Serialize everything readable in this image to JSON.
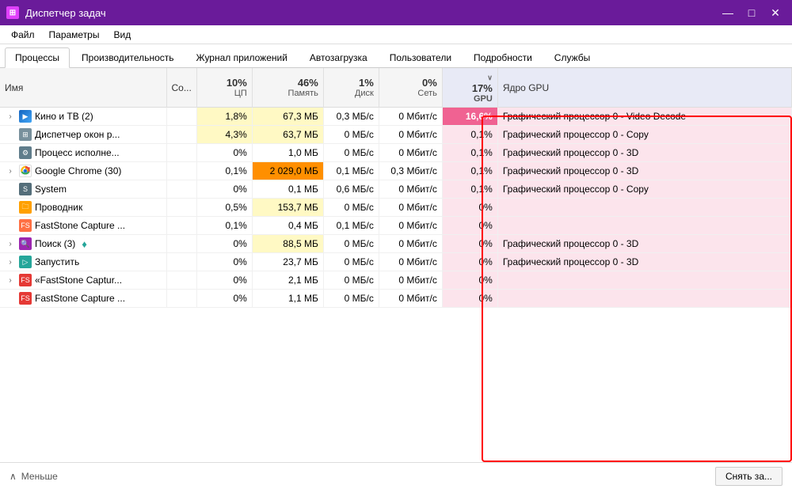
{
  "titleBar": {
    "icon": "⊞",
    "title": "Диспетчер задач",
    "minBtn": "—",
    "maxBtn": "□",
    "closeBtn": "✕"
  },
  "menuBar": {
    "items": [
      "Файл",
      "Параметры",
      "Вид"
    ]
  },
  "tabs": {
    "items": [
      "Процессы",
      "Производительность",
      "Журнал приложений",
      "Автозагрузка",
      "Пользователи",
      "Подробности",
      "Службы"
    ],
    "activeIndex": 0
  },
  "tableHeader": {
    "name": "Имя",
    "status": "Со...",
    "cpu": {
      "pct": "10%",
      "label": "ЦП"
    },
    "memory": {
      "pct": "46%",
      "label": "Память"
    },
    "disk": {
      "pct": "1%",
      "label": "Диск"
    },
    "network": {
      "pct": "0%",
      "label": "Сеть"
    },
    "gpu": {
      "pct": "17%",
      "label": "GPU",
      "sortIndicator": "∨"
    },
    "gpuEngine": "Ядро GPU"
  },
  "processes": [
    {
      "hasExpand": true,
      "iconType": "kino",
      "iconText": "▶",
      "name": "Кино и ТВ (2)",
      "status": "",
      "cpu": "1,8%",
      "memory": "67,3 МБ",
      "disk": "0,3 МБ/с",
      "network": "0 Мбит/с",
      "gpu": "16,6%",
      "gpuEngine": "Графический процессор 0 - Video Decode",
      "cpuHeat": "heat-low",
      "memHeat": "heat-low",
      "gpuHeat": "heat-high"
    },
    {
      "hasExpand": false,
      "iconType": "disp",
      "iconText": "⊞",
      "name": "Диспетчер окон р...",
      "status": "",
      "cpu": "4,3%",
      "memory": "63,7 МБ",
      "disk": "0 МБ/с",
      "network": "0 Мбит/с",
      "gpu": "0,1%",
      "gpuEngine": "Графический процессор 0 - Copy",
      "cpuHeat": "heat-low",
      "memHeat": "heat-low",
      "gpuHeat": "heat-none"
    },
    {
      "hasExpand": false,
      "iconType": "proc",
      "iconText": "⚙",
      "name": "Процесс исполне...",
      "status": "",
      "cpu": "0%",
      "memory": "1,0 МБ",
      "disk": "0 МБ/с",
      "network": "0 Мбит/с",
      "gpu": "0,1%",
      "gpuEngine": "Графический процессор 0 - 3D",
      "cpuHeat": "heat-none",
      "memHeat": "heat-none",
      "gpuHeat": "heat-none"
    },
    {
      "hasExpand": true,
      "iconType": "chrome",
      "iconText": "chrome",
      "name": "Google Chrome (30)",
      "status": "",
      "cpu": "0,1%",
      "memory": "2 029,0 МБ",
      "disk": "0,1 МБ/с",
      "network": "0,3 Мбит/с",
      "gpu": "0,1%",
      "gpuEngine": "Графический процессор 0 - 3D",
      "cpuHeat": "heat-none",
      "memHeat": "heat-high",
      "gpuHeat": "heat-none"
    },
    {
      "hasExpand": false,
      "iconType": "system",
      "iconText": "S",
      "name": "System",
      "status": "",
      "cpu": "0%",
      "memory": "0,1 МБ",
      "disk": "0,6 МБ/с",
      "network": "0 Мбит/с",
      "gpu": "0,1%",
      "gpuEngine": "Графический процессор 0 - Copy",
      "cpuHeat": "heat-none",
      "memHeat": "heat-none",
      "gpuHeat": "heat-none"
    },
    {
      "hasExpand": false,
      "iconType": "folder",
      "iconText": "📁",
      "name": "Проводник",
      "status": "",
      "cpu": "0,5%",
      "memory": "153,7 МБ",
      "disk": "0 МБ/с",
      "network": "0 Мбит/с",
      "gpu": "0%",
      "gpuEngine": "",
      "cpuHeat": "heat-none",
      "memHeat": "heat-low",
      "gpuHeat": "heat-none"
    },
    {
      "hasExpand": false,
      "iconType": "faststone",
      "iconText": "F",
      "name": "FastStone Capture ...",
      "status": "",
      "cpu": "0,1%",
      "memory": "0,4 МБ",
      "disk": "0,1 МБ/с",
      "network": "0 Мбит/с",
      "gpu": "0%",
      "gpuEngine": "",
      "cpuHeat": "heat-none",
      "memHeat": "heat-none",
      "gpuHeat": "heat-none"
    },
    {
      "hasExpand": true,
      "iconType": "search",
      "iconText": "🔍",
      "name": "Поиск (3)",
      "status": "pin",
      "cpu": "0%",
      "memory": "88,5 МБ",
      "disk": "0 МБ/с",
      "network": "0 Мбит/с",
      "gpu": "0%",
      "gpuEngine": "Графический процессор 0 - 3D",
      "cpuHeat": "heat-none",
      "memHeat": "heat-low",
      "gpuHeat": "heat-none"
    },
    {
      "hasExpand": true,
      "iconType": "run",
      "iconText": "▷",
      "name": "Запустить",
      "status": "",
      "cpu": "0%",
      "memory": "23,7 МБ",
      "disk": "0 МБ/с",
      "network": "0 Мбит/с",
      "gpu": "0%",
      "gpuEngine": "Графический процессор 0 - 3D",
      "cpuHeat": "heat-none",
      "memHeat": "heat-none",
      "gpuHeat": "heat-none"
    },
    {
      "hasExpand": true,
      "iconType": "faststone2",
      "iconText": "F",
      "name": "«FastStone Captur...",
      "status": "",
      "cpu": "0%",
      "memory": "2,1 МБ",
      "disk": "0 МБ/с",
      "network": "0 Мбит/с",
      "gpu": "0%",
      "gpuEngine": "",
      "cpuHeat": "heat-none",
      "memHeat": "heat-none",
      "gpuHeat": "heat-none"
    },
    {
      "hasExpand": false,
      "iconType": "faststone2",
      "iconText": "F",
      "name": "FastStone Capture ...",
      "status": "",
      "cpu": "0%",
      "memory": "1,1 МБ",
      "disk": "0 МБ/с",
      "network": "0 Мбит/с",
      "gpu": "0%",
      "gpuEngine": "",
      "cpuHeat": "heat-none",
      "memHeat": "heat-none",
      "gpuHeat": "heat-none"
    }
  ],
  "footer": {
    "lessLabel": "Меньше",
    "actionBtn": "Снять за..."
  }
}
